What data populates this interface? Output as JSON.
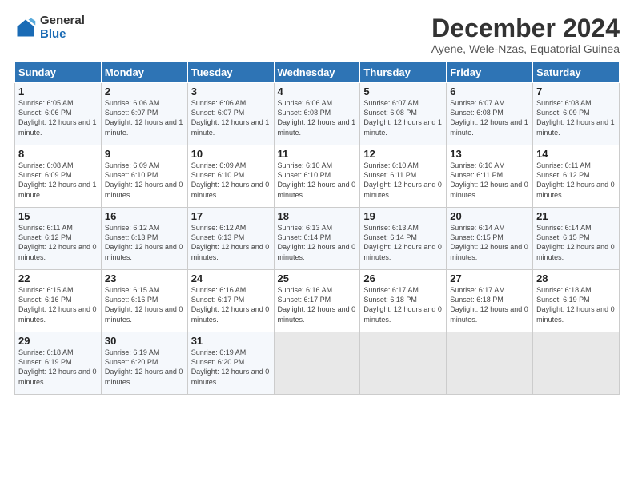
{
  "logo": {
    "general": "General",
    "blue": "Blue"
  },
  "title": "December 2024",
  "subtitle": "Ayene, Wele-Nzas, Equatorial Guinea",
  "days_of_week": [
    "Sunday",
    "Monday",
    "Tuesday",
    "Wednesday",
    "Thursday",
    "Friday",
    "Saturday"
  ],
  "weeks": [
    [
      {
        "day": "1",
        "sunrise": "6:05 AM",
        "sunset": "6:06 PM",
        "daylight": "12 hours and 1 minute."
      },
      {
        "day": "2",
        "sunrise": "6:06 AM",
        "sunset": "6:07 PM",
        "daylight": "12 hours and 1 minute."
      },
      {
        "day": "3",
        "sunrise": "6:06 AM",
        "sunset": "6:07 PM",
        "daylight": "12 hours and 1 minute."
      },
      {
        "day": "4",
        "sunrise": "6:06 AM",
        "sunset": "6:08 PM",
        "daylight": "12 hours and 1 minute."
      },
      {
        "day": "5",
        "sunrise": "6:07 AM",
        "sunset": "6:08 PM",
        "daylight": "12 hours and 1 minute."
      },
      {
        "day": "6",
        "sunrise": "6:07 AM",
        "sunset": "6:08 PM",
        "daylight": "12 hours and 1 minute."
      },
      {
        "day": "7",
        "sunrise": "6:08 AM",
        "sunset": "6:09 PM",
        "daylight": "12 hours and 1 minute."
      }
    ],
    [
      {
        "day": "8",
        "sunrise": "6:08 AM",
        "sunset": "6:09 PM",
        "daylight": "12 hours and 1 minute."
      },
      {
        "day": "9",
        "sunrise": "6:09 AM",
        "sunset": "6:10 PM",
        "daylight": "12 hours and 0 minutes."
      },
      {
        "day": "10",
        "sunrise": "6:09 AM",
        "sunset": "6:10 PM",
        "daylight": "12 hours and 0 minutes."
      },
      {
        "day": "11",
        "sunrise": "6:10 AM",
        "sunset": "6:10 PM",
        "daylight": "12 hours and 0 minutes."
      },
      {
        "day": "12",
        "sunrise": "6:10 AM",
        "sunset": "6:11 PM",
        "daylight": "12 hours and 0 minutes."
      },
      {
        "day": "13",
        "sunrise": "6:10 AM",
        "sunset": "6:11 PM",
        "daylight": "12 hours and 0 minutes."
      },
      {
        "day": "14",
        "sunrise": "6:11 AM",
        "sunset": "6:12 PM",
        "daylight": "12 hours and 0 minutes."
      }
    ],
    [
      {
        "day": "15",
        "sunrise": "6:11 AM",
        "sunset": "6:12 PM",
        "daylight": "12 hours and 0 minutes."
      },
      {
        "day": "16",
        "sunrise": "6:12 AM",
        "sunset": "6:13 PM",
        "daylight": "12 hours and 0 minutes."
      },
      {
        "day": "17",
        "sunrise": "6:12 AM",
        "sunset": "6:13 PM",
        "daylight": "12 hours and 0 minutes."
      },
      {
        "day": "18",
        "sunrise": "6:13 AM",
        "sunset": "6:14 PM",
        "daylight": "12 hours and 0 minutes."
      },
      {
        "day": "19",
        "sunrise": "6:13 AM",
        "sunset": "6:14 PM",
        "daylight": "12 hours and 0 minutes."
      },
      {
        "day": "20",
        "sunrise": "6:14 AM",
        "sunset": "6:15 PM",
        "daylight": "12 hours and 0 minutes."
      },
      {
        "day": "21",
        "sunrise": "6:14 AM",
        "sunset": "6:15 PM",
        "daylight": "12 hours and 0 minutes."
      }
    ],
    [
      {
        "day": "22",
        "sunrise": "6:15 AM",
        "sunset": "6:16 PM",
        "daylight": "12 hours and 0 minutes."
      },
      {
        "day": "23",
        "sunrise": "6:15 AM",
        "sunset": "6:16 PM",
        "daylight": "12 hours and 0 minutes."
      },
      {
        "day": "24",
        "sunrise": "6:16 AM",
        "sunset": "6:17 PM",
        "daylight": "12 hours and 0 minutes."
      },
      {
        "day": "25",
        "sunrise": "6:16 AM",
        "sunset": "6:17 PM",
        "daylight": "12 hours and 0 minutes."
      },
      {
        "day": "26",
        "sunrise": "6:17 AM",
        "sunset": "6:18 PM",
        "daylight": "12 hours and 0 minutes."
      },
      {
        "day": "27",
        "sunrise": "6:17 AM",
        "sunset": "6:18 PM",
        "daylight": "12 hours and 0 minutes."
      },
      {
        "day": "28",
        "sunrise": "6:18 AM",
        "sunset": "6:19 PM",
        "daylight": "12 hours and 0 minutes."
      }
    ],
    [
      {
        "day": "29",
        "sunrise": "6:18 AM",
        "sunset": "6:19 PM",
        "daylight": "12 hours and 0 minutes."
      },
      {
        "day": "30",
        "sunrise": "6:19 AM",
        "sunset": "6:20 PM",
        "daylight": "12 hours and 0 minutes."
      },
      {
        "day": "31",
        "sunrise": "6:19 AM",
        "sunset": "6:20 PM",
        "daylight": "12 hours and 0 minutes."
      },
      null,
      null,
      null,
      null
    ]
  ]
}
